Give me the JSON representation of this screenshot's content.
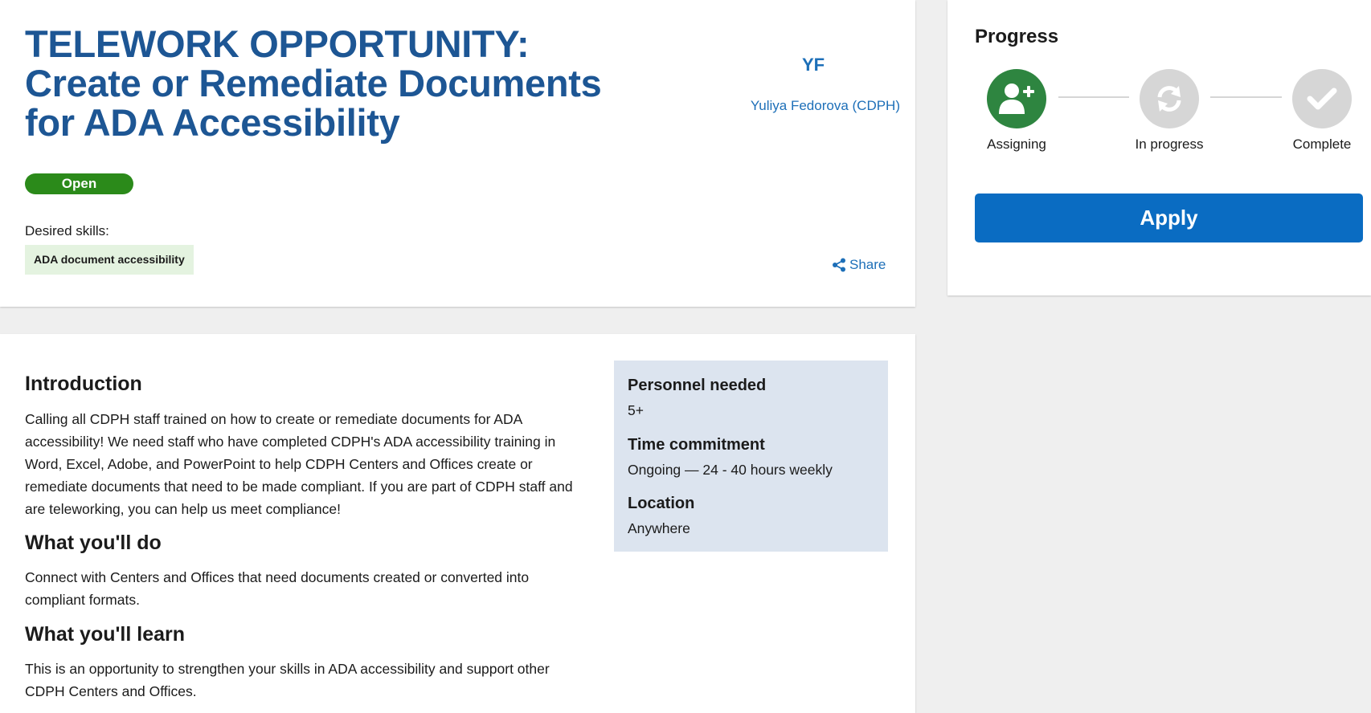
{
  "opportunity": {
    "title_lines": [
      "TELEWORK OPPORTUNITY:",
      "Create or Remediate Documents",
      "for ADA Accessibility"
    ],
    "status": "Open",
    "skills_label": "Desired skills:",
    "skills": [
      "ADA document accessibility"
    ],
    "owner_initials": "YF",
    "owner_name": "Yuliya Fedorova (CDPH)",
    "share_label": "Share"
  },
  "progress": {
    "title": "Progress",
    "steps": [
      {
        "label": "Assigning",
        "state": "active",
        "icon": "user-plus-icon",
        "color": "#2e8540"
      },
      {
        "label": "In progress",
        "state": "inactive",
        "icon": "sync-icon",
        "color": "#d6d6d6"
      },
      {
        "label": "Complete",
        "state": "inactive",
        "icon": "check-icon",
        "color": "#d6d6d6"
      }
    ],
    "apply_label": "Apply"
  },
  "details": {
    "sections": [
      {
        "heading": "Introduction",
        "text": "Calling all CDPH staff trained on how to create or remediate documents for ADA accessibility! We need staff who have completed CDPH's ADA accessibility training in Word, Excel, Adobe, and PowerPoint to help CDPH Centers and Offices create or remediate documents that need to be made compliant. If you are part of CDPH staff and are teleworking, you can help us meet compliance!"
      },
      {
        "heading": "What you'll do",
        "text": "Connect with Centers and Offices that need documents created or converted into compliant formats."
      },
      {
        "heading": "What you'll learn",
        "text": "This is an opportunity to strengthen your skills in ADA accessibility and support other CDPH Centers and Offices."
      }
    ],
    "info": [
      {
        "label": "Personnel needed",
        "value": "5+"
      },
      {
        "label": "Time commitment",
        "value": "Ongoing — 24 - 40 hours weekly"
      },
      {
        "label": "Location",
        "value": "Anywhere"
      }
    ]
  },
  "colors": {
    "title": "#1d5694",
    "link": "#1d6fb8",
    "status_open": "#2b8a1a",
    "skill_chip": "#e4f3e0",
    "apply_button": "#0a6cc2",
    "info_box": "#dce4ef"
  }
}
